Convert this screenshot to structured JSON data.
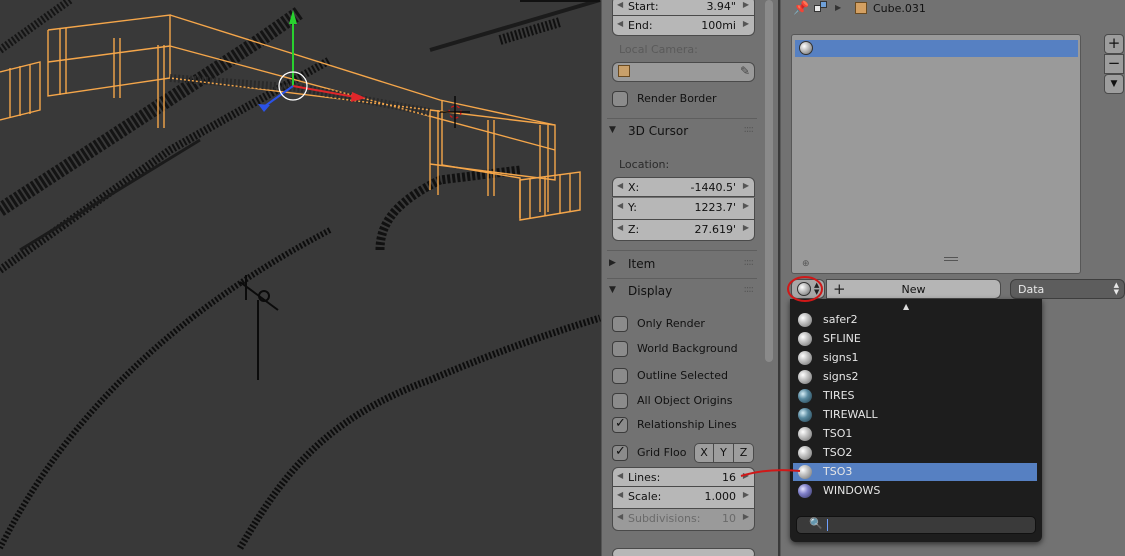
{
  "n_panel": {
    "view_clip": {
      "start": {
        "label": "Start:",
        "value": "3.94\""
      },
      "end": {
        "label": "End:",
        "value": "100mi"
      }
    },
    "local_camera_label": "Local Camera:",
    "render_border_label": "Render Border",
    "cursor_section": {
      "title": "3D Cursor",
      "location_label": "Location:",
      "x": {
        "label": "X:",
        "value": "-1440.5'"
      },
      "y": {
        "label": "Y:",
        "value": "1223.7'"
      },
      "z": {
        "label": "Z:",
        "value": "27.619'"
      }
    },
    "item_section_title": "Item",
    "display_section": {
      "title": "Display",
      "only_render": {
        "label": "Only Render",
        "checked": false
      },
      "world_background": {
        "label": "World Background",
        "checked": false
      },
      "outline_selected": {
        "label": "Outline Selected",
        "checked": false
      },
      "all_object_origins": {
        "label": "All Object Origins",
        "checked": false
      },
      "relationship_lines": {
        "label": "Relationship Lines",
        "checked": true
      },
      "grid_floor": {
        "label": "Grid Floo",
        "checked": true
      },
      "axis_x": "X",
      "axis_y": "Y",
      "axis_z": "Z",
      "lines": {
        "label": "Lines:",
        "value": "16"
      },
      "scale": {
        "label": "Scale:",
        "value": "1.000"
      },
      "subdivisions": {
        "label": "Subdivisions:",
        "value": "10"
      }
    }
  },
  "properties": {
    "breadcrumb_object": "Cube.031",
    "new_button_label": "New",
    "link_select_value": "Data",
    "side_buttons": [
      "+",
      "−",
      "▼"
    ]
  },
  "material_menu": {
    "items": [
      {
        "name": "safer2",
        "swatch": "grey"
      },
      {
        "name": "SFLINE",
        "swatch": "grey"
      },
      {
        "name": "signs1",
        "swatch": "grey"
      },
      {
        "name": "signs2",
        "swatch": "grey"
      },
      {
        "name": "TIRES",
        "swatch": "teal"
      },
      {
        "name": "TIREWALL",
        "swatch": "teal"
      },
      {
        "name": "TSO1",
        "swatch": "grey"
      },
      {
        "name": "TSO2",
        "swatch": "grey"
      },
      {
        "name": "TSO3",
        "swatch": "grey",
        "selected": true
      },
      {
        "name": "WINDOWS",
        "swatch": "purple"
      }
    ],
    "search_value": ""
  },
  "colors": {
    "selection": "#5680c2",
    "wire_selected": "#f5a64a",
    "annotation_red": "#d01818",
    "gizmo_red": "#e0262a",
    "gizmo_green": "#29d12f",
    "gizmo_blue": "#2b52e6"
  }
}
